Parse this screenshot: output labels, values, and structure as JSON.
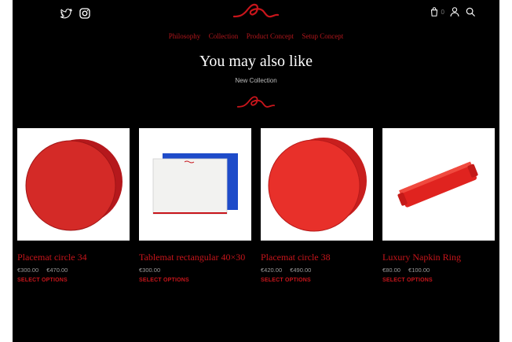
{
  "header": {
    "cart_count": "0",
    "icons": [
      "twitter-icon",
      "instagram-icon",
      "cart-icon",
      "user-icon",
      "search-icon"
    ],
    "brand_color": "#c8151b"
  },
  "nav": {
    "items": [
      {
        "label": "Philosophy"
      },
      {
        "label": "Collection"
      },
      {
        "label": "Product Concept"
      },
      {
        "label": "Setup Concept"
      }
    ]
  },
  "section": {
    "title": "You may also like",
    "subtitle": "New Collection"
  },
  "products": [
    {
      "name": "Placemat circle 34",
      "price_min": "€300.00",
      "price_max": "€470.00",
      "action": "SELECT OPTIONS"
    },
    {
      "name": "Tablemat rectangular 40×30",
      "price": "€300.00",
      "action": "SELECT OPTIONS"
    },
    {
      "name": "Placemat circle 38",
      "price_min": "€420.00",
      "price_max": "€490.00",
      "action": "SELECT OPTIONS"
    },
    {
      "name": "Luxury Napkin Ring",
      "price_min": "€80.00",
      "price_max": "€100.00",
      "action": "SELECT OPTIONS"
    }
  ]
}
